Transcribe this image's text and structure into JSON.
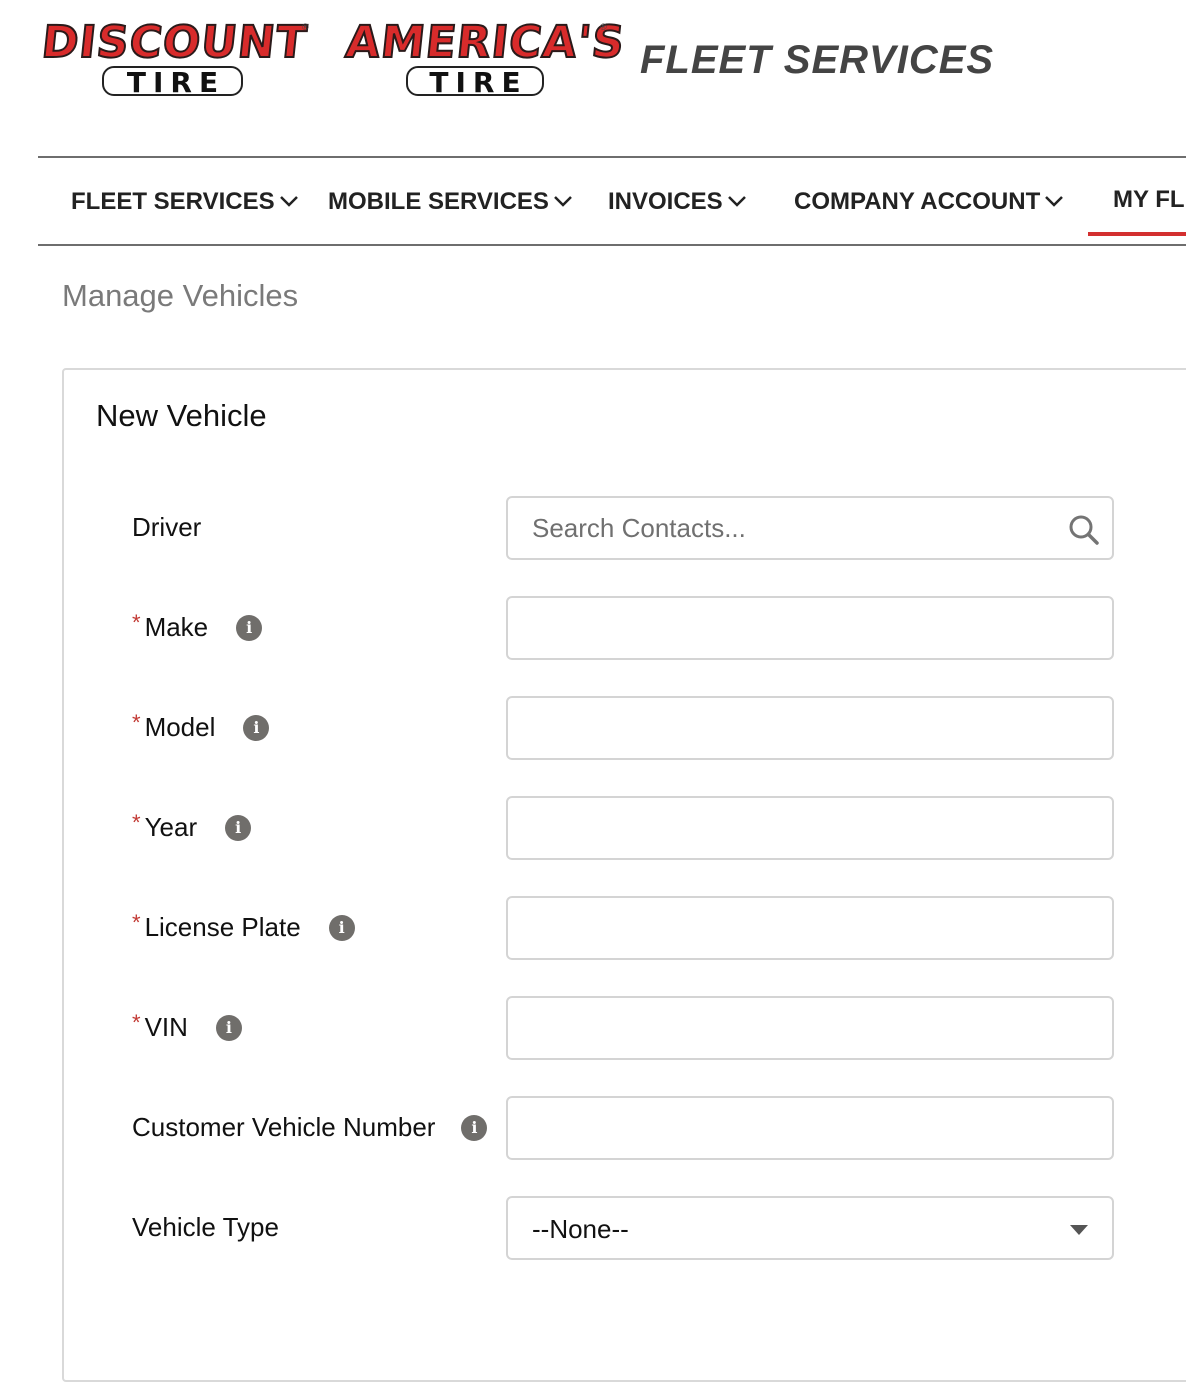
{
  "header": {
    "logo_discount_word": "DISCOUNT",
    "logo_discount_tire": "TIRE",
    "logo_americas_word": "AMERICA'S",
    "logo_americas_tire": "TIRE",
    "title": "FLEET SERVICES",
    "logo_color": "#d82b2b"
  },
  "nav": {
    "items": [
      {
        "label": "FLEET SERVICES",
        "icon": "chevron-down-icon"
      },
      {
        "label": "MOBILE SERVICES",
        "icon": "chevron-down-icon"
      },
      {
        "label": "INVOICES",
        "icon": "chevron-down-icon"
      },
      {
        "label": "COMPANY ACCOUNT",
        "icon": "chevron-down-icon"
      },
      {
        "label": "MY FLI",
        "active": true
      }
    ],
    "active_color": "#d32f2f"
  },
  "page": {
    "title": "Manage Vehicles"
  },
  "form": {
    "title": "New Vehicle",
    "required_color": "#c23934",
    "fields": [
      {
        "label": "Driver",
        "required": false,
        "info": false,
        "type": "search",
        "placeholder": "Search Contacts...",
        "value": "",
        "icon": "search-icon"
      },
      {
        "label": "Make",
        "required": true,
        "info": true,
        "type": "text",
        "value": ""
      },
      {
        "label": "Model",
        "required": true,
        "info": true,
        "type": "text",
        "value": ""
      },
      {
        "label": "Year",
        "required": true,
        "info": true,
        "type": "text",
        "value": ""
      },
      {
        "label": "License Plate",
        "required": true,
        "info": true,
        "type": "text",
        "value": ""
      },
      {
        "label": "VIN",
        "required": true,
        "info": true,
        "type": "text",
        "value": ""
      },
      {
        "label": "Customer Vehicle Number",
        "required": false,
        "info": true,
        "type": "text",
        "value": ""
      },
      {
        "label": "Vehicle Type",
        "required": false,
        "info": false,
        "type": "select",
        "selected": "--None--",
        "icon": "caret-down-icon"
      }
    ],
    "required_marker": "*",
    "info_glyph": "i"
  }
}
